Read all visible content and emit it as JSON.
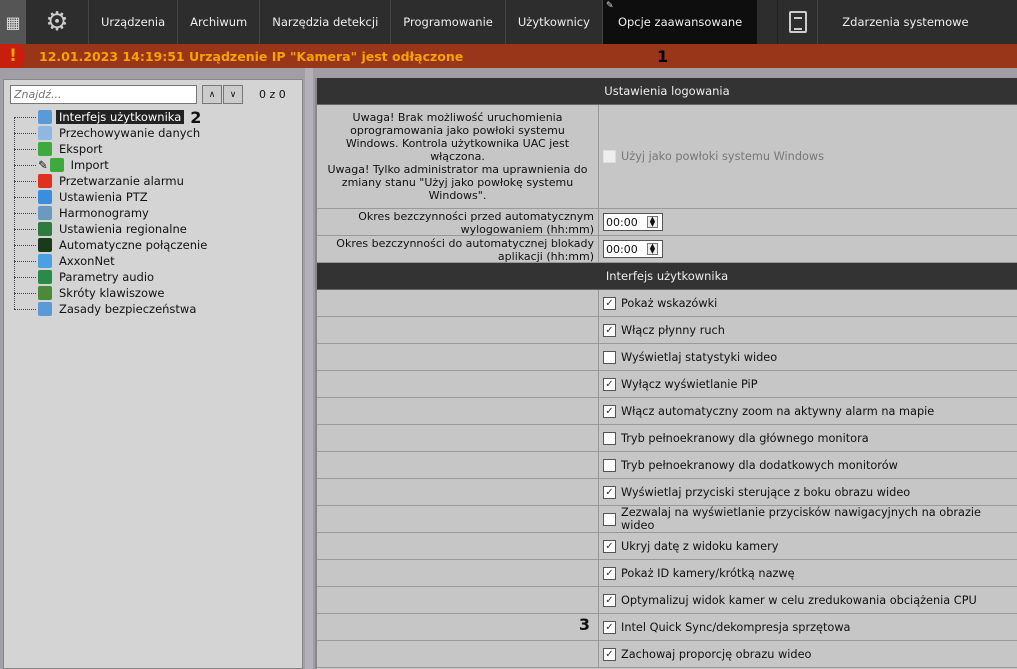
{
  "topbar": {
    "tabs": [
      "Urządzenia",
      "Archiwum",
      "Narzędzia detekcji",
      "Programowanie",
      "Użytkownicy"
    ],
    "active_tab": "Opcje zaawansowane",
    "events_tab": "Zdarzenia systemowe"
  },
  "alert": {
    "icon": "!",
    "message": "12.01.2023 14:19:51 Urządzenie IP \"Kamera\" jest odłączone",
    "annotation": "1"
  },
  "sidebar": {
    "search_placeholder": "Znajdź...",
    "count": "0 z 0",
    "up": "^",
    "down": "v",
    "annotation": "2",
    "items": [
      {
        "label": "Interfejs użytkownika",
        "color": "#5a9ad8"
      },
      {
        "label": "Przechowywanie danych",
        "color": "#8fb8e0"
      },
      {
        "label": "Eksport",
        "color": "#3caa3c"
      },
      {
        "label": "Import",
        "color": "#3caa3c"
      },
      {
        "label": "Przetwarzanie alarmu",
        "color": "#e03020"
      },
      {
        "label": "Ustawienia PTZ",
        "color": "#3a8ee0"
      },
      {
        "label": "Harmonogramy",
        "color": "#6a9ac0"
      },
      {
        "label": "Ustawienia regionalne",
        "color": "#2f7a3f"
      },
      {
        "label": "Automatyczne połączenie",
        "color": "#1a3a1a"
      },
      {
        "label": "AxxonNet",
        "color": "#4aa0e0"
      },
      {
        "label": "Parametry audio",
        "color": "#2a8a4a"
      },
      {
        "label": "Skróty klawiszowe",
        "color": "#4a8a3a"
      },
      {
        "label": "Zasady bezpieczeństwa",
        "color": "#5a9ad8"
      }
    ]
  },
  "logging": {
    "header": "Ustawienia logowania",
    "warning": "Uwaga! Brak możliwość uruchomienia oprogramowania jako powłoki systemu Windows. Kontrola użytkownika UAC jest włączona.\nUwaga! Tylko administrator ma uprawnienia do zmiany stanu \"Użyj jako powłokę systemu Windows\".",
    "shell_label": "Użyj jako powłoki systemu Windows",
    "logout_label": "Okres bezczynności przed automatycznym wylogowaniem (hh:mm)",
    "logout_value": "00:00",
    "lock_label": "Okres bezczynności do automatycznej blokady aplikacji (hh:mm)",
    "lock_value": "00:00"
  },
  "ui": {
    "header": "Interfejs użytkownika",
    "annotation": "3",
    "options": [
      {
        "label": "Pokaż wskazówki",
        "checked": true
      },
      {
        "label": "Włącz płynny ruch",
        "checked": true
      },
      {
        "label": "Wyświetlaj statystyki wideo",
        "checked": false
      },
      {
        "label": "Wyłącz wyświetlanie PiP",
        "checked": true
      },
      {
        "label": "Włącz automatyczny zoom na aktywny alarm na mapie",
        "checked": true
      },
      {
        "label": "Tryb pełnoekranowy dla głównego monitora",
        "checked": false
      },
      {
        "label": "Tryb pełnoekranowy dla dodatkowych monitorów",
        "checked": false
      },
      {
        "label": "Wyświetlaj przyciski sterujące z boku obrazu wideo",
        "checked": true
      },
      {
        "label": "Zezwalaj na wyświetlanie przycisków nawigacyjnych na obrazie wideo",
        "checked": false
      },
      {
        "label": "Ukryj datę z widoku kamery",
        "checked": true
      },
      {
        "label": "Pokaż ID kamery/krótką nazwę",
        "checked": true
      },
      {
        "label": "Optymalizuj widok kamer w celu zredukowania obciążenia CPU",
        "checked": true
      },
      {
        "label": "Intel Quick Sync/dekompresja sprzętowa",
        "checked": true
      },
      {
        "label": "Zachowaj proporcję obrazu wideo",
        "checked": true
      }
    ]
  }
}
